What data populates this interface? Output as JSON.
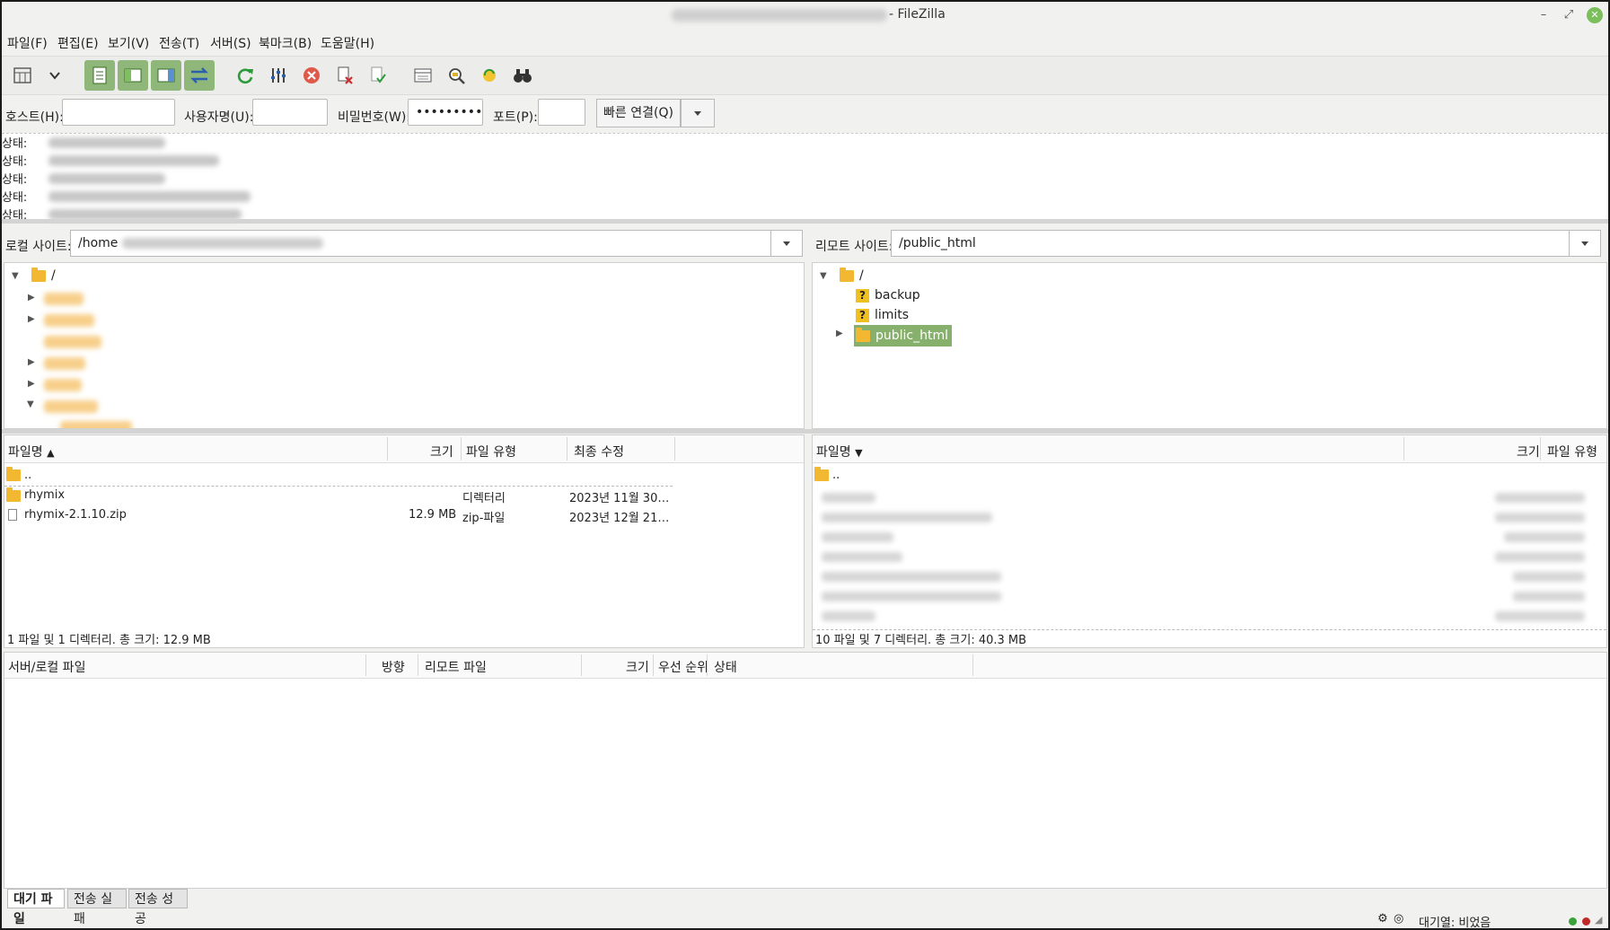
{
  "window": {
    "title": "- FileZilla"
  },
  "menu": [
    "파일(F)",
    "편집(E)",
    "보기(V)",
    "전송(T)",
    "서버(S)",
    "북마크(B)",
    "도움말(H)"
  ],
  "quickconnect": {
    "host_label": "호스트(H):",
    "host_value": "",
    "user_label": "사용자명(U):",
    "user_value": "",
    "password_label": "비밀번호(W):",
    "password_value": "•••••••••",
    "port_label": "포트(P):",
    "port_value": "",
    "connect_label": "빠른 연결(Q)"
  },
  "log": {
    "prefix": "상태:"
  },
  "local": {
    "site_label": "로컬 사이트:",
    "path": "/home",
    "tree_root": "/",
    "columns": [
      "파일명",
      "크기",
      "파일 유형",
      "최종 수정"
    ],
    "files": [
      {
        "name": "..",
        "size": "",
        "type": "",
        "modified": ""
      },
      {
        "name": "rhymix",
        "size": "",
        "type": "디렉터리",
        "modified": "2023년 11월 30…"
      },
      {
        "name": "rhymix-2.1.10.zip",
        "size": "12.9 MB",
        "type": "zip-파일",
        "modified": "2023년 12월 21…"
      }
    ],
    "summary": "1 파일 및 1 디렉터리. 총 크기: 12.9 MB"
  },
  "remote": {
    "site_label": "리모트 사이트:",
    "path": "/public_html",
    "tree_root": "/",
    "tree_items": [
      "backup",
      "limits",
      "public_html"
    ],
    "columns": [
      "파일명",
      "크기",
      "파일 유형"
    ],
    "parent_dir": "..",
    "summary": "10 파일 및 7 디렉터리. 총 크기: 40.3 MB"
  },
  "queue": {
    "columns": [
      "서버/로컬 파일",
      "방향",
      "리모트 파일",
      "크기",
      "우선 순위",
      "상태"
    ],
    "tabs": [
      "대기 파일",
      "전송 실패",
      "전송 성공"
    ]
  },
  "statusbar": {
    "queue_text": "대기열: 비었음"
  }
}
